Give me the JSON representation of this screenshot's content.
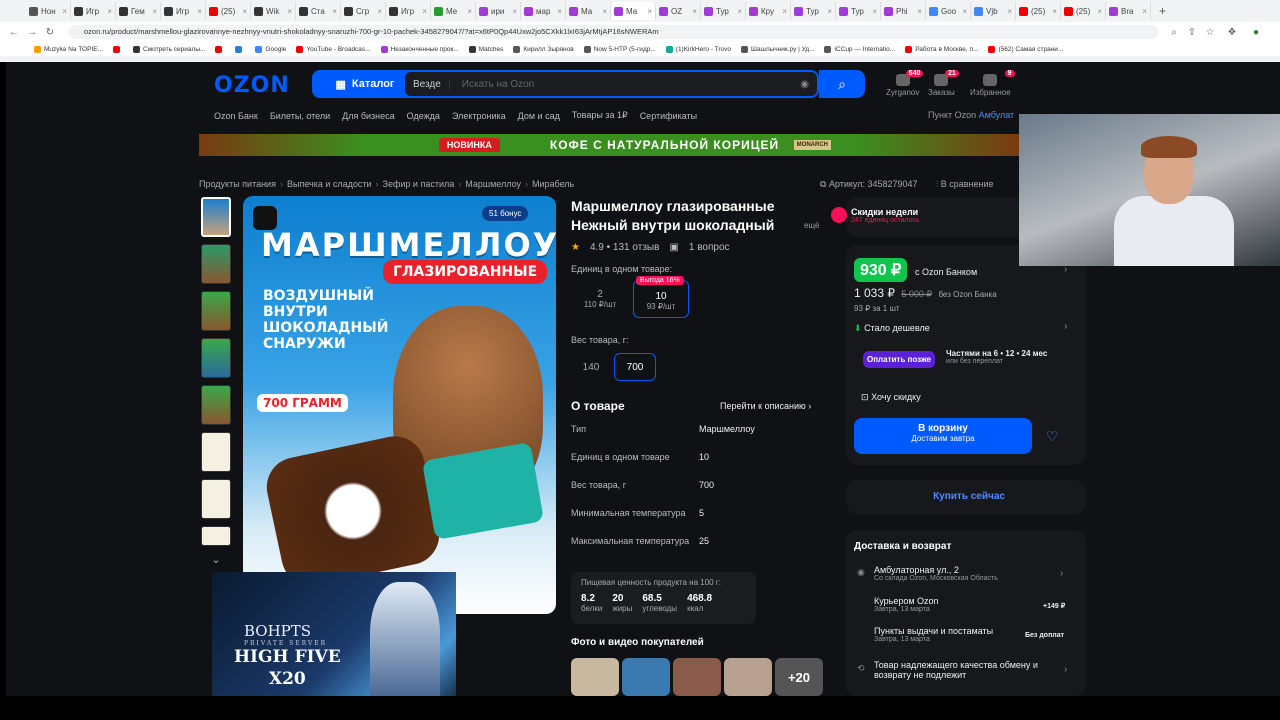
{
  "browser": {
    "tabs": [
      {
        "label": "Hон",
        "color": "#555"
      },
      {
        "label": "Игр",
        "color": "#333"
      },
      {
        "label": "Гем",
        "color": "#333"
      },
      {
        "label": "Игр",
        "color": "#333"
      },
      {
        "label": "(25)",
        "color": "#e00"
      },
      {
        "label": "Wik",
        "color": "#333"
      },
      {
        "label": "Ста",
        "color": "#333"
      },
      {
        "label": "Сгр",
        "color": "#333"
      },
      {
        "label": "Игр",
        "color": "#333"
      },
      {
        "label": "Ме",
        "color": "#2a9a2a"
      },
      {
        "label": "ири",
        "color": "#a23ad8"
      },
      {
        "label": "мар",
        "color": "#a23ad8"
      },
      {
        "label": "Ма",
        "color": "#a23ad8"
      },
      {
        "label": "Ма",
        "color": "#a23ad8",
        "active": true
      },
      {
        "label": "OZ",
        "color": "#a23ad8"
      },
      {
        "label": "Тур",
        "color": "#a23ad8"
      },
      {
        "label": "Кру",
        "color": "#a23ad8"
      },
      {
        "label": "Тур",
        "color": "#a23ad8"
      },
      {
        "label": "Тур",
        "color": "#a23ad8"
      },
      {
        "label": "Phi",
        "color": "#a23ad8"
      },
      {
        "label": "Goo",
        "color": "#4285f4"
      },
      {
        "label": "Vjb",
        "color": "#4285f4"
      },
      {
        "label": "(25)",
        "color": "#e00"
      },
      {
        "label": "(25)",
        "color": "#e00"
      },
      {
        "label": "Bra",
        "color": "#a23ad8"
      }
    ],
    "new_tab": "+",
    "url": "ozon.ru/product/marshmellou-glazirovannye-nezhnyy-vnutri-shokoladnyy-snaruzhi-700-gr-10-pachek-3458279047/?at=x6tP0Qp44Uxw2jo5CXkk1lxI63jArMtjAP16sNWERAm",
    "bookmarks": [
      {
        "label": "Muzyka Na TOPIE...",
        "color": "#f90"
      },
      {
        "label": "",
        "color": "#e00"
      },
      {
        "label": "Смотреть сериалы...",
        "color": "#333"
      },
      {
        "label": "",
        "color": "#e00"
      },
      {
        "label": "",
        "color": "#2a7de1"
      },
      {
        "label": "Google",
        "color": "#4285f4"
      },
      {
        "label": "YouTube - Broadcas...",
        "color": "#e00"
      },
      {
        "label": "Незаконченные прок...",
        "color": "#a23ad8"
      },
      {
        "label": "Matches",
        "color": "#333"
      },
      {
        "label": "Кирилл Зырянов",
        "color": "#555"
      },
      {
        "label": "Now 5-HTP (5-гидр...",
        "color": "#555"
      },
      {
        "label": "(1)KirkHero - Trovo",
        "color": "#1a9"
      },
      {
        "label": "Шашлычник.ру | Уд...",
        "color": "#555"
      },
      {
        "label": "iCCup — Internatio...",
        "color": "#555"
      },
      {
        "label": "Работа в Москве, п...",
        "color": "#e00"
      },
      {
        "label": "(562) Самая страни...",
        "color": "#e00"
      }
    ]
  },
  "header": {
    "logo": "OZON",
    "catalog": "Каталог",
    "search_scope": "Везде",
    "search_placeholder": "Искать на Ozon",
    "icons": [
      {
        "label": "Zyrganov",
        "badge": "540"
      },
      {
        "label": "Заказы",
        "badge": "21"
      },
      {
        "label": "Избранное",
        "badge": "9"
      }
    ],
    "subnav": [
      "Ozon Банк",
      "Билеты, отели",
      "Для бизнеса",
      "Одежда",
      "Электроника",
      "Дом и сад",
      "Товары за 1₽",
      "Сертификаты"
    ],
    "pickup": "Пункт Ozon",
    "pickup_place": "Амбулат"
  },
  "banner": {
    "new": "НОВИНКА",
    "text": "КОФЕ С НАТУРАЛЬНОЙ КОРИЦЕЙ",
    "brand": "MONARCH"
  },
  "breadcrumbs": [
    "Продукты питания",
    "Выпечка и сладости",
    "Зефир и пастила",
    "Маршмеллоу",
    "Мирабель"
  ],
  "article": "Артикул: 3458279047",
  "compare": "В сравнение",
  "product": {
    "image_title": "МАРШМЕЛЛОУ",
    "image_sub": "ГЛАЗИРОВАННЫЕ",
    "image_text": "ВОЗДУШНЫЙ ВНУТРИ ШОКОЛАДНЫЙ СНАРУЖИ",
    "image_gram": "700 ГРАММ",
    "bonus": "51 бонус",
    "title": "Маршмеллоу глазированные Нежный внутри шоколадный",
    "more": "ещё",
    "rating": "4.9 • 131 отзыв",
    "questions": "1 вопрос",
    "units_label": "Единиц в одном товаре:",
    "unit_options": [
      {
        "value": "2",
        "price": "110 ₽/шт"
      },
      {
        "value": "10",
        "price": "93 ₽/шт",
        "selected": true
      }
    ],
    "vygoda": "Выгода 16%",
    "weight_label": "Вес товара, г:",
    "weight_options": [
      {
        "value": "140"
      },
      {
        "value": "700",
        "selected": true
      }
    ],
    "about_title": "О товаре",
    "about_link": "Перейти к описанию",
    "specs": [
      {
        "k": "Тип",
        "v": "Маршмеллоу"
      },
      {
        "k": "Единиц в одном товаре",
        "v": "10"
      },
      {
        "k": "Вес товара, г",
        "v": "700"
      },
      {
        "k": "Минимальная температура",
        "v": "5"
      },
      {
        "k": "Максимальная температура",
        "v": "25"
      }
    ],
    "nutrition_title": "Пищевая ценность продукта на 100 г:",
    "nutrition": [
      {
        "v": "8.2",
        "k": "белки"
      },
      {
        "v": "20",
        "k": "жиры"
      },
      {
        "v": "68.5",
        "k": "углеводы"
      },
      {
        "v": "468.8",
        "k": "ккал"
      }
    ],
    "photos_title": "Фото и видео покупателей",
    "photos_more": "+20"
  },
  "buy": {
    "discount_title": "Скидки недели",
    "discount_sub": "247 единиц осталось",
    "price": "930 ₽",
    "price_label": "с Ozon Банком",
    "price_without": "1 033 ₽",
    "price_old": "5 000 ₽",
    "price_without_label": "без Ozon Банка",
    "per_unit": "93 ₽ за 1 шт",
    "cheaper": "Стало дешевле",
    "pay_later": "Оплатить позже",
    "parts": "Частями на 6 • 12 • 24 мес",
    "parts_sub": "или без переплат",
    "want_discount": "Хочу скидку",
    "cart": "В корзину",
    "cart_sub": "Доставим завтра",
    "buy_now": "Купить сейчас",
    "delivery_title": "Доставка и возврат",
    "address": "Амбулаторная ул., 2",
    "address_sub": "Со склада Ozon, Московская Область",
    "courier": "Курьером Ozon",
    "courier_date": "Завтра, 13 марта",
    "courier_price": "+149 ₽",
    "pickup": "Пункты выдачи и постаматы",
    "pickup_date": "Завтра, 13 марта",
    "pickup_price": "Без доплат",
    "return": "Товар надлежащего качества обмену и возврату не подлежит"
  },
  "ad": {
    "brand": "BOHPTS",
    "brand_sub": "PRIVATE SERVER",
    "line1": "HIGH FIVE",
    "line2": "X20"
  }
}
